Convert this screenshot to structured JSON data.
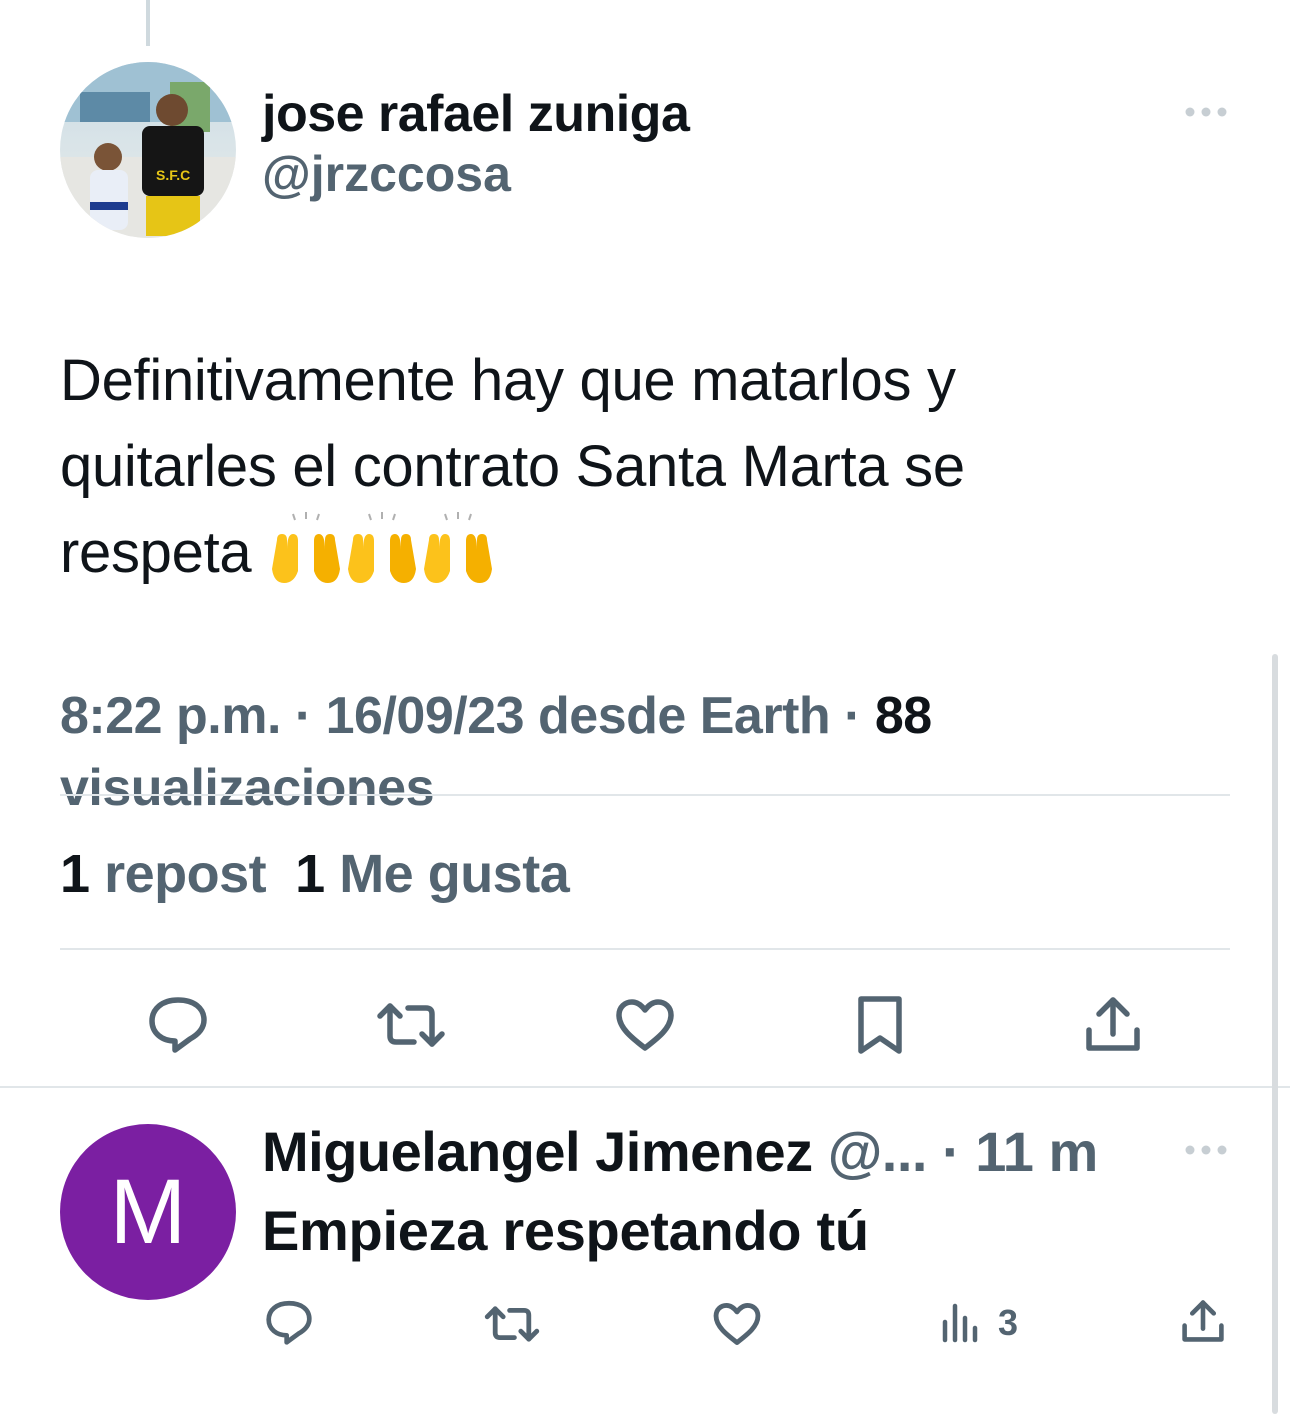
{
  "tweet": {
    "author_name": "jose rafael zuniga",
    "author_handle": "@jrzccosa",
    "text_line1": "Definitivamente hay que matarlos y",
    "text_line2": "quitarles el contrato  Santa Marta se",
    "text_line3": "respeta",
    "emoji": "raising-hands-emoji",
    "time": "8:22 p.m.",
    "sep1": " · ",
    "date": "16/09/23",
    "source": " desde Earth",
    "sep2": " · ",
    "views_count": "88",
    "views_label": "visualizaciones",
    "reposts_count": "1",
    "reposts_label": "repost",
    "likes_count": "1",
    "likes_label": "Me gusta"
  },
  "reply": {
    "avatar_letter": "M",
    "author_name": "Miguelangel Jimenez",
    "author_handle": "@...",
    "sep": " · ",
    "time": "11 m",
    "text": "Empieza respetando tú",
    "views": "3"
  },
  "colors": {
    "text": "#0f1419",
    "secondary": "#536471",
    "divider": "#e1e6e9",
    "reply_avatar": "#7b1fa2"
  },
  "icons": {
    "main_actions": [
      "reply-icon",
      "repost-icon",
      "like-icon",
      "bookmark-icon",
      "share-icon"
    ],
    "reply_actions": [
      "reply-icon",
      "repost-icon",
      "like-icon",
      "views-icon",
      "share-icon"
    ]
  }
}
